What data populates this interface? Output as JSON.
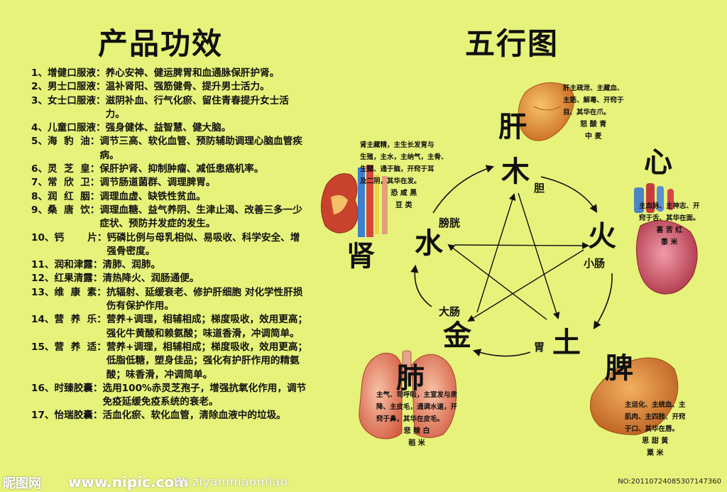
{
  "titles": {
    "left": "产品功效",
    "right": "五行图"
  },
  "products": [
    {
      "label": "1、增健口服液：",
      "desc": "养心安神、健运脾胃和血通脉保肝护肾。"
    },
    {
      "label": "2、男士口服液：",
      "desc": "温补肾阳、强筋健骨、提升男士活力。"
    },
    {
      "label": "3、女士口服液：",
      "desc": "滋阴补血、行气化瘀、留住青春提升女士活力。"
    },
    {
      "label": "4、儿童口服液：",
      "desc": "强身健体、益智慧、健大脑。"
    },
    {
      "label": "5、海  豹  油：",
      "desc": "调节三高、软化血管、预防辅助调理心脑血管疾病。"
    },
    {
      "label": "6、灵  芝  皇：",
      "desc": "保肝护肾、抑制肿瘤、减低患癌机率。"
    },
    {
      "label": "7、常  欣  卫：",
      "desc": "调节肠道菌群、调理脾胃。"
    },
    {
      "label": "8、润  红  胭：",
      "desc": "调理血虚、缺铁性贫血。"
    },
    {
      "label": "9、桑  唐  饮：",
      "desc": "调理血糖、益气养阴、生津止渴、改善三多一少症状、预防并发症的发生。"
    },
    {
      "label": "10、钙       片：",
      "desc": "钙磷比例与母乳相似、易吸收、科学安全、增强骨密度。"
    },
    {
      "label": "11、润和津露：",
      "desc": "清肺、润肺。"
    },
    {
      "label": "12、红果清露：",
      "desc": "清热降火、润肠通便。"
    },
    {
      "label": "13、维  康  素：",
      "desc": "抗辐射、延缓衰老、修护肝细胞 对化学性肝损伤有保护作用。"
    },
    {
      "label": "14、营  养  乐：",
      "desc": "营养+调理，相辅相成；梯度吸收，效用更高；强化牛黄酸和赖氨酸；味道香滑，冲调简单。"
    },
    {
      "label": "15、营  养  适：",
      "desc": "营养+调理，相辅相成；梯度吸收，效用更高；低脂低糖，塑身佳品；强化有护肝作用的精氨酸；味香滑，冲调简单。"
    },
    {
      "label": "16、时臻胶囊：",
      "desc": "选用100%赤灵芝孢子，增强抗氧化作用，调节免疫延缓免疫系统的衰老。"
    },
    {
      "label": "17、怡瑞胶囊：",
      "desc": "活血化瘀、软化血管，清除血液中的垃圾。"
    }
  ],
  "elements": {
    "wood": "木",
    "fire": "火",
    "earth": "土",
    "metal": "金",
    "water": "水"
  },
  "organs": {
    "liver": "肝",
    "heart": "心",
    "spleen": "脾",
    "lung": "肺",
    "kidney": "肾"
  },
  "fu_organs": {
    "gallbladder": "胆",
    "small_intestine": "小肠",
    "stomach": "胃",
    "large_intestine": "大肠",
    "bladder": "膀胱"
  },
  "notes": {
    "liver": {
      "lines": [
        "肝主疏泄、主藏血、",
        "主筋、解毒、开窍于",
        "目、其华在爪。"
      ],
      "extra": [
        "怒 酸 青",
        "中 麦"
      ]
    },
    "heart": {
      "lines": [
        "主血脉、主神志、开",
        "窍于舌、其华在面。"
      ],
      "extra": [
        "喜 苦 红",
        "黍 米"
      ]
    },
    "spleen": {
      "lines": [
        "主运化、主统血、主",
        "肌肉、主四肢、开窍",
        "于口、其华在唇。"
      ],
      "extra": [
        "思 甜 黄",
        "粟 米"
      ]
    },
    "lung": {
      "lines": [
        "主气、司呼吸，主宣发与肃",
        "降、主皮毛，通调水道，开",
        "窍于鼻，其华在皮毛。"
      ],
      "extra": [
        "悲 辣 白",
        "稻 米"
      ]
    },
    "kidney": {
      "lines": [
        "肾主藏精，主生长发育与",
        "生殖，主水，主纳气，主骨、",
        "生髓、通于脑，开窍于耳",
        "及二阴，其华在发。"
      ],
      "extra": [
        "恐 咸 黑",
        "豆 类"
      ]
    }
  },
  "footer": {
    "brand": "昵图网",
    "site": "www.nipic.com",
    "author": "BY:ziyanmiaomiao",
    "image_no": "NO:20110724085307147360"
  },
  "colors": {
    "background": "#e6f27a",
    "liver": "#e8902c",
    "heart": "#c43a4e",
    "spleen": "#d77a2c",
    "lung": "#df6a52",
    "kidney": "#c9432c"
  }
}
